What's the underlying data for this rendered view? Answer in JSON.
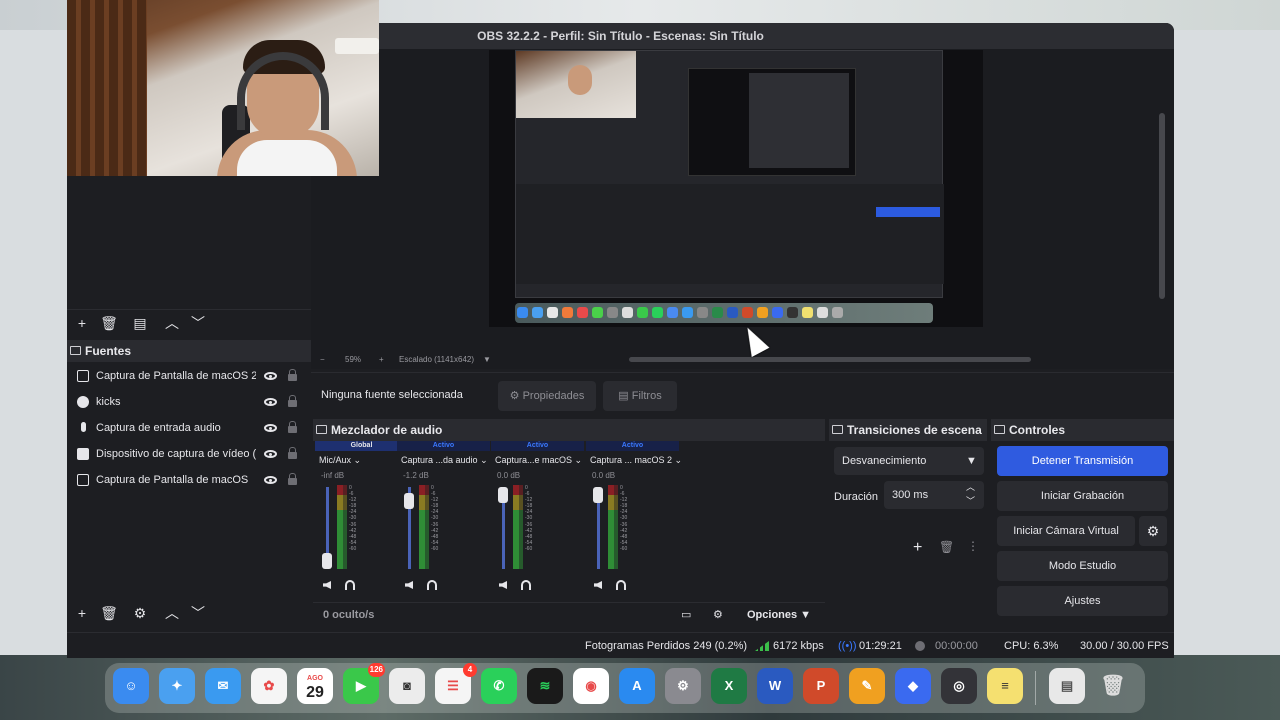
{
  "window": {
    "title": "OBS 32.2.2 - Perfil: Sin Título - Escenas: Sin Título"
  },
  "preview": {
    "zoom": "59%",
    "scaling": "Escalado (1141x642)"
  },
  "sources": {
    "title": "Fuentes",
    "items": [
      {
        "label": "Captura de Pantalla de macOS 2",
        "icon": "monitor-icon"
      },
      {
        "label": "kicks",
        "icon": "gamepad-icon"
      },
      {
        "label": "Captura de entrada audio",
        "icon": "microphone-icon"
      },
      {
        "label": "Dispositivo de captura de vídeo (h",
        "icon": "camera-icon"
      },
      {
        "label": "Captura de Pantalla de macOS",
        "icon": "monitor-icon"
      }
    ]
  },
  "properties_bar": {
    "no_selection": "Ninguna fuente seleccionada",
    "properties": "Propiedades",
    "filters": "Filtros"
  },
  "mixer": {
    "title": "Mezclador de audio",
    "channels": [
      {
        "tag": "Global",
        "name": "Mic/Aux",
        "db": "-inf dB"
      },
      {
        "tag": "Activo",
        "name": "Captura ...da audio",
        "db": "-1.2 dB"
      },
      {
        "tag": "Activo",
        "name": "Captura...e macOS",
        "db": "0.0 dB"
      },
      {
        "tag": "Activo",
        "name": "Captura ... macOS 2",
        "db": "0.0 dB"
      }
    ],
    "scale": [
      "0",
      "-6",
      "-12",
      "-18",
      "-24",
      "-30",
      "-36",
      "-42",
      "-48",
      "-54",
      "-60"
    ],
    "hidden": "0 oculto/s",
    "options": "Opciones"
  },
  "transitions": {
    "title": "Transiciones de escena",
    "selected": "Desvanecimiento",
    "duration_label": "Duración",
    "duration_value": "300 ms"
  },
  "controls": {
    "title": "Controles",
    "stop_stream": "Detener Transmisión",
    "start_record": "Iniciar Grabación",
    "start_virtual_cam": "Iniciar Cámara Virtual",
    "studio_mode": "Modo Estudio",
    "settings": "Ajustes"
  },
  "status": {
    "dropped_frames": "Fotogramas Perdidos 249 (0.2%)",
    "bitrate": "6172 kbps",
    "stream_time": "01:29:21",
    "record_time": "00:00:00",
    "cpu": "CPU: 6.3%",
    "fps": "30.00 / 30.00 FPS"
  },
  "dock": {
    "calendar_month": "AGO",
    "calendar_day": "29",
    "facetime_badge": "126",
    "reminders_badge": "4"
  },
  "colors": {
    "accent": "#2f5be0",
    "panel": "#1d1e22",
    "header": "#2a2b30"
  }
}
